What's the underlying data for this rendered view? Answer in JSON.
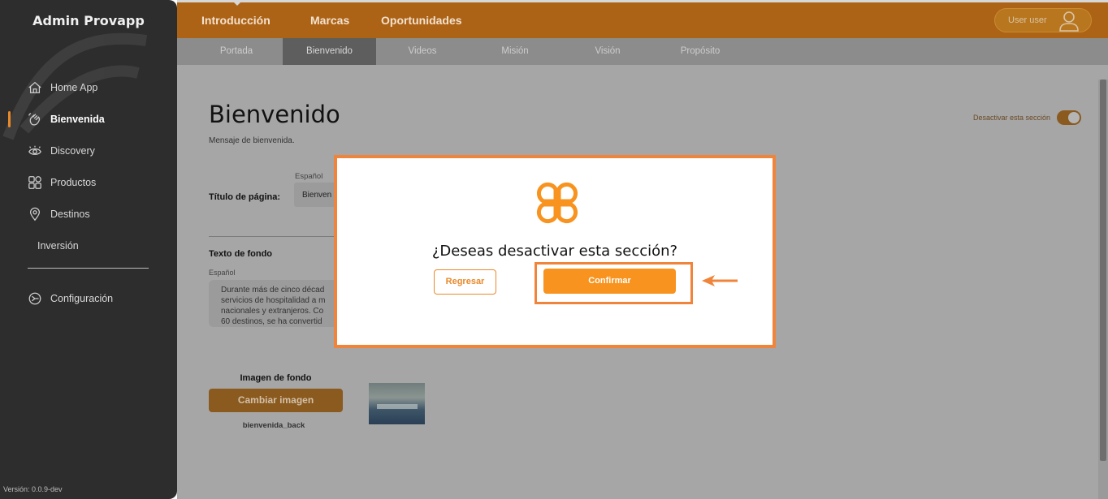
{
  "sidebar": {
    "brand": "Admin Provapp",
    "items": [
      {
        "label": "Home App",
        "icon": "home-icon"
      },
      {
        "label": "Bienvenida",
        "icon": "wave-hand-icon",
        "active": true
      },
      {
        "label": "Discovery",
        "icon": "eye-icon"
      },
      {
        "label": "Productos",
        "icon": "grid-icon"
      },
      {
        "label": "Destinos",
        "icon": "location-pin-icon"
      },
      {
        "label": "Inversión",
        "icon": ""
      }
    ],
    "config_label": "Configuración",
    "version": "Versión: 0.0.9-dev"
  },
  "topnav": {
    "tabs": [
      "Introducción",
      "Marcas",
      "Oportunidades"
    ],
    "active_tab": "Introducción",
    "user_label": "User user"
  },
  "subnav": {
    "tabs": [
      "Portada",
      "Bienvenido",
      "Videos",
      "Misión",
      "Visión",
      "Propósito"
    ],
    "active_tab": "Bienvenido"
  },
  "content": {
    "title": "Bienvenido",
    "subtitle": "Mensaje de bienvenida.",
    "toggle_label": "Desactivar esta sección",
    "toggle_on": true,
    "lang_label_1": "Español",
    "page_title_label": "Título de página:",
    "page_title_value": "Bienven",
    "background_text_label": "Texto de fondo",
    "lang_label_2": "Español",
    "background_text_lines": [
      "Durante más de cinco décad",
      "servicios de hospitalidad a m",
      "nacionales y extranjeros. Co",
      "60 destinos, se ha convertid"
    ],
    "background_image_label": "Imagen de fondo",
    "change_image_button": "Cambiar imagen",
    "image_filename": "bienvenida_back"
  },
  "modal": {
    "question": "¿Deseas desactivar esta sección?",
    "back_button": "Regresar",
    "confirm_button": "Confirmar"
  },
  "colors": {
    "accent": "#f7931e",
    "topbar": "#ad6316",
    "sidebar": "#2d2d2d",
    "highlight": "#f0843a"
  }
}
